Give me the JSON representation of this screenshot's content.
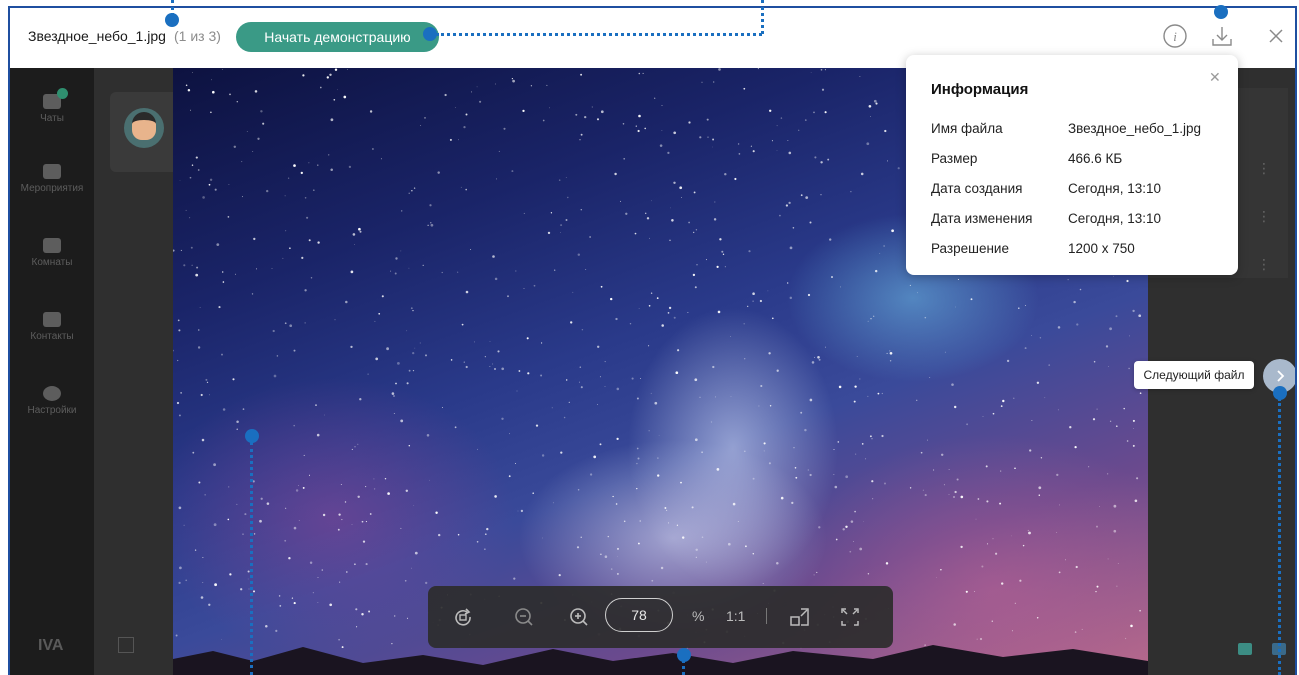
{
  "topbar": {
    "filename": "Звездное_небо_1.jpg",
    "counter": "(1 из 3)",
    "demo_button": "Начать демонстрацию"
  },
  "info": {
    "title": "Информация",
    "rows": [
      {
        "label": "Имя файла",
        "value": "Звездное_небо_1.jpg"
      },
      {
        "label": "Размер",
        "value": "466.6 КБ"
      },
      {
        "label": "Дата создания",
        "value": "Сегодня, 13:10"
      },
      {
        "label": "Дата изменения",
        "value": "Сегодня, 13:10"
      },
      {
        "label": "Разрешение",
        "value": "1200 x 750"
      }
    ]
  },
  "nav": {
    "items": [
      {
        "label": "Чаты"
      },
      {
        "label": "Мероприятия"
      },
      {
        "label": "Комнаты"
      },
      {
        "label": "Контакты"
      },
      {
        "label": "Настройки"
      }
    ],
    "logo": "IVA"
  },
  "zoom": {
    "value": "78",
    "percent_sign": "%",
    "one_to_one": "1:1"
  },
  "next_file": {
    "tooltip": "Следующий файл"
  },
  "colors": {
    "accent": "#3a9a86",
    "callout": "#1a6fc0",
    "frame": "#1f4fa0"
  }
}
